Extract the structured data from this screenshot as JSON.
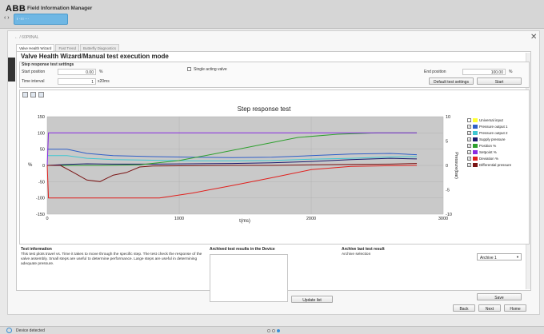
{
  "app": {
    "logo": "ABB",
    "title": "Field Information Manager",
    "device_chip": "ı ·ı ı ···",
    "nav": "‹ ›"
  },
  "breadcrumb": "← / 60P8NAL",
  "tabs": [
    {
      "label": "Valve Health Wizard"
    },
    {
      "label": "Fast Trend"
    },
    {
      "label": "Butterfly Diagnostics"
    }
  ],
  "page_title": "Valve Health Wizard/Manual test execution mode",
  "settings": {
    "section_title": "Step response test settings",
    "start_position_label": "Start position",
    "start_position_value": "0.00",
    "start_position_unit": "%",
    "time_interval_label": "Time interval",
    "time_interval_value": "1",
    "time_interval_unit": "x20ms",
    "single_acting_label": "Single acting valve",
    "end_position_label": "End position",
    "end_position_value": "100.00",
    "end_position_unit": "%",
    "default_button": "Default test settings",
    "start_button": "Start"
  },
  "chart_data": {
    "type": "line",
    "title": "Step response test",
    "xlabel": "t(ms)",
    "ylabel": "%",
    "y2label": "Pressure(bar)",
    "xlim": [
      0,
      3000
    ],
    "ylim": [
      -150,
      150
    ],
    "y2lim": [
      -10,
      10
    ],
    "x_ticks": [
      "0",
      "1000",
      "2000",
      "3000"
    ],
    "y_ticks": [
      "150",
      "100",
      "50",
      "0",
      "-50",
      "-100",
      "-150"
    ],
    "y2_ticks": [
      "10",
      "5",
      "0",
      "-5",
      "-10"
    ],
    "grid": true,
    "legend_position": "right",
    "series": [
      {
        "name": "Universal input",
        "color": "#ffff33",
        "checked": false,
        "axis": "left",
        "x": [],
        "y": []
      },
      {
        "name": "Pressure output 1",
        "color": "#2f5fc8",
        "checked": true,
        "axis": "left",
        "x": [
          0,
          150,
          300,
          500,
          800,
          1100,
          1400,
          1700,
          2000,
          2300,
          2600,
          2800
        ],
        "y": [
          50,
          50,
          37,
          30,
          27,
          25,
          24,
          25,
          30,
          35,
          37,
          33
        ]
      },
      {
        "name": "Pressure output 2",
        "color": "#3fc7d2",
        "checked": true,
        "axis": "left",
        "x": [
          0,
          150,
          300,
          500,
          800,
          1100,
          1400,
          1700,
          2000,
          2300,
          2600,
          2800
        ],
        "y": [
          30,
          30,
          22,
          18,
          16,
          14,
          14,
          15,
          19,
          22,
          26,
          27
        ]
      },
      {
        "name": "Supply pressure",
        "color": "#1a1a6e",
        "checked": true,
        "axis": "left",
        "x": [
          0,
          150,
          300,
          500,
          800,
          1100,
          1400,
          1700,
          2000,
          2300,
          2600,
          2800
        ],
        "y": [
          0,
          3,
          5,
          4,
          4,
          5,
          6,
          8,
          12,
          18,
          22,
          20
        ]
      },
      {
        "name": "Position %",
        "color": "#2ea02e",
        "checked": true,
        "axis": "left",
        "x": [
          0,
          400,
          700,
          1000,
          1300,
          1600,
          1900,
          2200,
          2500,
          2800
        ],
        "y": [
          0,
          0,
          2,
          15,
          38,
          62,
          86,
          96,
          100,
          100
        ]
      },
      {
        "name": "Setpoint %",
        "color": "#8a2be2",
        "checked": true,
        "axis": "left",
        "x": [
          0,
          10,
          2800
        ],
        "y": [
          0,
          100,
          100
        ]
      },
      {
        "name": "Deviation %",
        "color": "#e0201d",
        "checked": true,
        "axis": "left",
        "x": [
          0,
          10,
          600,
          850,
          1100,
          1400,
          1700,
          2000,
          2300,
          2600,
          2800
        ],
        "y": [
          0,
          -100,
          -100,
          -100,
          -85,
          -62,
          -38,
          -13,
          -3,
          -1,
          0
        ]
      },
      {
        "name": "Differential pressure",
        "color": "#7a1414",
        "checked": true,
        "axis": "left",
        "x": [
          0,
          100,
          200,
          300,
          400,
          500,
          600,
          700,
          800,
          1100,
          1400,
          1700,
          2000,
          2300,
          2600,
          2800
        ],
        "y": [
          0,
          0,
          -22,
          -45,
          -50,
          -30,
          -22,
          -5,
          -2,
          -1,
          0,
          0,
          2,
          3,
          4,
          6
        ]
      }
    ]
  },
  "test_info": {
    "title": "Test information",
    "text": "This test plots travel vs. Time it takes to move through the specific step. The test check the response of the valve assembly. Small steps are useful to determine performance. Large steps are useful in determining adequate pressure."
  },
  "archived": {
    "title": "Archived test results in the Device",
    "update_button": "Update list"
  },
  "archive_last": {
    "title": "Archive last test result",
    "selection_label": "Archive selection",
    "selection_value": "Archive 1",
    "save_button": "Save"
  },
  "nav_buttons": {
    "back": "Back",
    "next": "Next",
    "home": "Home"
  },
  "status": {
    "text": "Device detected"
  }
}
